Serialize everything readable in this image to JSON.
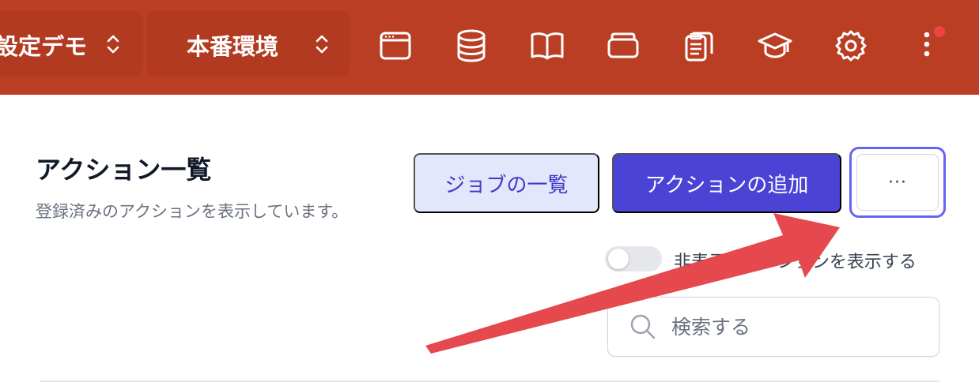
{
  "topbar": {
    "project_selector": "設定デモ",
    "environment_selector": "本番環境",
    "icons": [
      "window-icon",
      "database-icon",
      "book-icon",
      "archive-icon",
      "clipboard-icon",
      "graduation-cap-icon",
      "gear-icon",
      "more-vertical-icon"
    ],
    "background_color": "#b93e24",
    "notification_color": "#ef4444"
  },
  "page": {
    "title": "アクション一覧",
    "subtitle": "登録済みのアクションを表示しています。"
  },
  "actions": {
    "jobs_label": "ジョブの一覧",
    "add_label": "アクションの追加",
    "more_label": "···",
    "accent_color": "#4a43d6"
  },
  "filter": {
    "show_hidden_label": "非表示のアクションを表示する",
    "show_hidden_enabled": false
  },
  "search": {
    "placeholder": "検索する"
  },
  "annotation": {
    "type": "arrow",
    "color": "#e5484d",
    "points_to": "more-button"
  }
}
